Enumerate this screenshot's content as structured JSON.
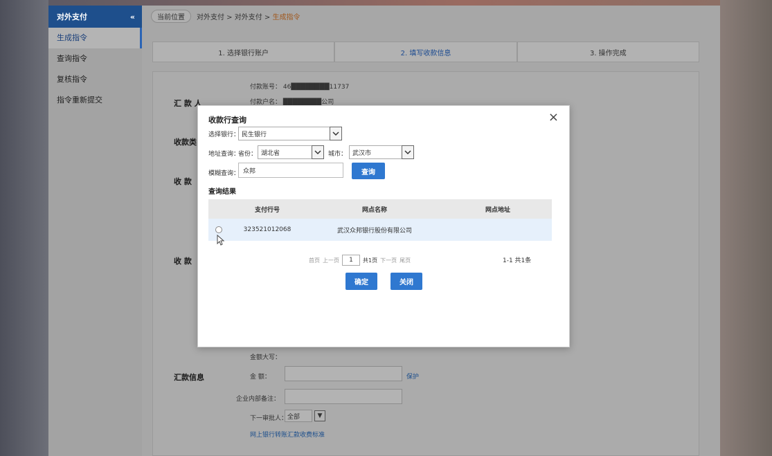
{
  "sidebar": {
    "header_label": "对外支付",
    "collapse_icon": "«",
    "items": [
      {
        "label": "生成指令"
      },
      {
        "label": "查询指令"
      },
      {
        "label": "复核指令"
      },
      {
        "label": "指令重新提交"
      }
    ]
  },
  "breadcrumb": {
    "home": "当前位置",
    "path": "对外支付 > 对外支付 > ",
    "current": "生成指令"
  },
  "steps": [
    {
      "label": "1. 选择银行账户"
    },
    {
      "label": "2. 填写收款信息"
    },
    {
      "label": "3. 操作完成"
    }
  ],
  "background_form": {
    "payer_label": "汇 款 人",
    "account_no": "付款账号：  46████████11737",
    "account_name": "付款户名：  ████████公司",
    "label_2": "收款类",
    "label_3": "收 款",
    "label_4": "收 款",
    "remit_label": "汇款信息",
    "amount_caption": "金额大写：",
    "amount_label": "金  额：",
    "amount_link": "保护",
    "remark_label": "企业内部备注：",
    "next_approver_label": "下一审批人：",
    "next_approver_value": "全部",
    "bottom_link": "网上银行转账汇款收费标准"
  },
  "modal": {
    "title": "收款行查询",
    "close_icon": "×",
    "bank_label": "选择银行：",
    "bank_value": "民生银行",
    "location_label": "地址查询：",
    "province_label": "省份：",
    "province_value": "湖北省",
    "city_label": "城市：",
    "city_value": "武汉市",
    "keyword_label": "模糊查询：",
    "keyword_value": "众邦",
    "search_button": "查询",
    "results_label": "查询结果",
    "table_headers": [
      "支付行号",
      "网点名称",
      "网点地址"
    ],
    "rows": [
      {
        "code": "323521012068",
        "name": "武汉众邦银行股份有限公司",
        "address": ""
      }
    ],
    "pager": {
      "first": "首页",
      "prev": "上一页",
      "page": "1",
      "total_pages": "共1页",
      "next": "下一页",
      "last": "尾页",
      "summary": "1-1  共1条"
    },
    "confirm_button": "确定",
    "close_button": "关闭"
  }
}
